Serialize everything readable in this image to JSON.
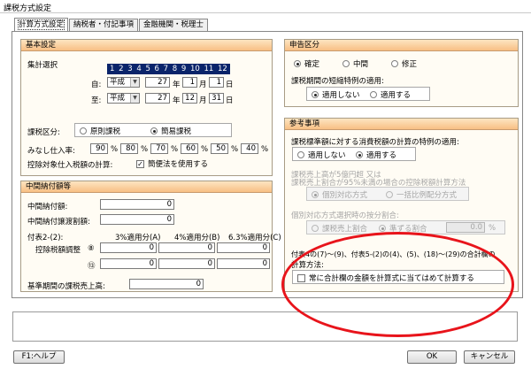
{
  "window": {
    "title": "課税方式設定"
  },
  "tabs": [
    "計算方式設定",
    "納税者・付記事項",
    "金融機関・税理士"
  ],
  "basic": {
    "header": "基本設定",
    "year_select_label": "集計選択",
    "years": "1 2 3 4 5 6 7 8 9 10 11 12",
    "from_label": "自:",
    "to_label": "至:",
    "from": {
      "era": "平成",
      "year": "27",
      "year_unit": "年",
      "month": "1",
      "month_unit": "月",
      "day": "1",
      "day_unit": "日"
    },
    "to": {
      "era": "平成",
      "year": "27",
      "year_unit": "年",
      "month": "12",
      "month_unit": "月",
      "day": "31",
      "day_unit": "日"
    },
    "tax_type_label": "課税区分:",
    "tax_type_options": [
      "原則課税",
      "簡易課税"
    ],
    "deemed_rate_label": "みなし仕入率:",
    "deemed_rates": [
      "90",
      "80",
      "70",
      "60",
      "50",
      "40"
    ],
    "percent": "%",
    "deduction_label": "控除対象仕入税額の計算:",
    "deduction_check": "簡便法を使用する"
  },
  "interim": {
    "header": "中間納付額等",
    "interim_tax_label": "中間納付額:",
    "interim_tax_value": "0",
    "interim_local_label": "中間納付譲渡割額:",
    "interim_local_value": "0",
    "attach_label": "付表2-(2):",
    "col_heads": [
      "3%適用分(A)",
      "4%適用分(B)",
      "6.3%適用分(C)"
    ],
    "deduct_label": "控除税額調整",
    "row_marks": [
      "⑧",
      "⑬"
    ],
    "row_values": [
      [
        "0",
        "0",
        "0"
      ],
      [
        "0",
        "0",
        "0"
      ]
    ],
    "base_sales_label": "基準期間の課税売上高:",
    "base_sales_value": "0"
  },
  "declaration": {
    "header": "申告区分",
    "options": [
      "確定",
      "中間",
      "修正"
    ],
    "short_period_label": "課税期間の短縮特例の適用:",
    "short_options": [
      "適用しない",
      "適用する"
    ]
  },
  "reference": {
    "header": "参考事項",
    "special_label": "課税標準額に対する消費税額の計算の特例の適用:",
    "special_options": [
      "適用しない",
      "適用する"
    ],
    "ratio_label_1": "課税売上高が5億円超 又は",
    "ratio_label_2": "課税売上割合が95%未満の場合の控除税額計算方法",
    "ratio_options": [
      "個別対応方式",
      "一括比例配分方式"
    ],
    "alloc_label": "個別対応方式選択時の按分割合:",
    "alloc_options": [
      "課税売上割合",
      "準ずる割合"
    ],
    "alloc_value": "0.0",
    "alloc_unit": "%",
    "calc_label_1": "付表4の(7)～(9)、付表5-(2)の(4)、(5)、(18)～(29)の合計欄の",
    "calc_label_2": "計算方法:",
    "calc_check": "常に合計欄の金額を計算式に当てはめて計算する"
  },
  "buttons": {
    "help": "F1:ヘルプ",
    "ok": "OK",
    "cancel": "キャンセル"
  },
  "colors": {
    "highlight_ellipse": "#e8141b",
    "panel_header": "#f8bf84",
    "selection": "#0a246a"
  }
}
